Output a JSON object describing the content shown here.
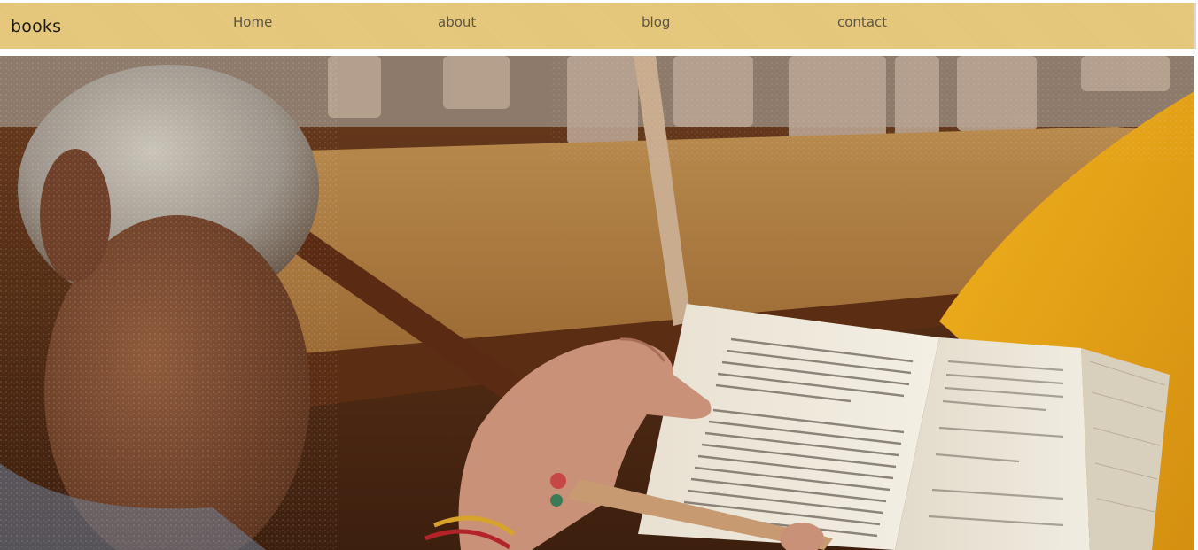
{
  "navbar": {
    "brand": "books",
    "links": [
      {
        "label": "Home"
      },
      {
        "label": "about"
      },
      {
        "label": "blog"
      },
      {
        "label": "contact"
      }
    ],
    "background_color": "#e8c97a"
  },
  "hero": {
    "image_subject": "person reading an open book",
    "accent_colors": [
      "#b5864a",
      "#e3a21a",
      "#5a2f16",
      "#f1ece1"
    ]
  }
}
